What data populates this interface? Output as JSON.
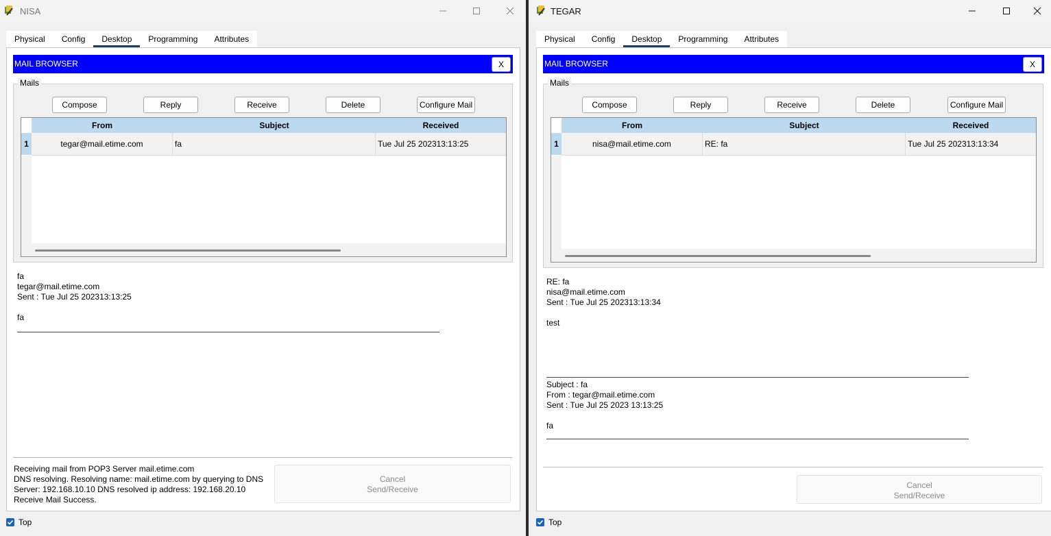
{
  "windows": {
    "nisa": {
      "title": "NISA",
      "tabs": [
        "Physical",
        "Config",
        "Desktop",
        "Programming",
        "Attributes"
      ],
      "active_tab": "Desktop",
      "browser_title": "MAIL BROWSER",
      "close_label": "X",
      "mails_legend": "Mails",
      "buttons": {
        "compose": "Compose",
        "reply": "Reply",
        "receive": "Receive",
        "delete": "Delete",
        "configure": "Configure Mail"
      },
      "columns": {
        "from": "From",
        "subject": "Subject",
        "received": "Received"
      },
      "rows": [
        {
          "num": "1",
          "from": "tegar@mail.etime.com",
          "subject": "fa",
          "received": "Tue Jul 25 202313:13:25"
        }
      ],
      "message": {
        "lines": [
          "fa",
          "tegar@mail.etime.com",
          "Sent : Tue Jul 25 202313:13:25",
          "",
          "fa"
        ]
      },
      "status": {
        "line1": "Receiving mail from POP3 Server mail.etime.com",
        "line2": "DNS resolving. Resolving name: mail.etime.com by querying to DNS",
        "line3": "Server: 192.168.10.10  DNS resolved ip address: 192.168.20.10",
        "line4": "Receive Mail Success."
      },
      "cancel_line1": "Cancel",
      "cancel_line2": "Send/Receive",
      "top_label": "Top",
      "top_checked": true
    },
    "tegar": {
      "title": "TEGAR",
      "tabs": [
        "Physical",
        "Config",
        "Desktop",
        "Programming",
        "Attributes"
      ],
      "active_tab": "Desktop",
      "browser_title": "MAIL BROWSER",
      "close_label": "X",
      "mails_legend": "Mails",
      "buttons": {
        "compose": "Compose",
        "reply": "Reply",
        "receive": "Receive",
        "delete": "Delete",
        "configure": "Configure Mail"
      },
      "columns": {
        "from": "From",
        "subject": "Subject",
        "received": "Received"
      },
      "rows": [
        {
          "num": "1",
          "from": "nisa@mail.etime.com",
          "subject": "RE: fa",
          "received": "Tue Jul 25 202313:13:34"
        }
      ],
      "message": {
        "lines": [
          "RE: fa",
          "nisa@mail.etime.com",
          "Sent : Tue Jul 25 202313:13:34",
          "",
          "test"
        ],
        "quoted_lines": [
          "Subject : fa",
          "From : tegar@mail.etime.com",
          "Sent : Tue Jul 25 2023 13:13:25",
          "",
          "fa"
        ]
      },
      "cancel_line1": "Cancel",
      "cancel_line2": "Send/Receive",
      "top_label": "Top",
      "top_checked": true
    }
  },
  "colors": {
    "header_blue": "#0000ff",
    "table_header": "#bcd9f0",
    "active_tab_underline": "#1f3d5e",
    "checkbox": "#1e62b4"
  },
  "icons": {
    "app": "packet-tracer-pc-icon",
    "minimize": "minimize-icon",
    "maximize": "maximize-icon",
    "close": "close-icon",
    "check": "check-icon"
  }
}
